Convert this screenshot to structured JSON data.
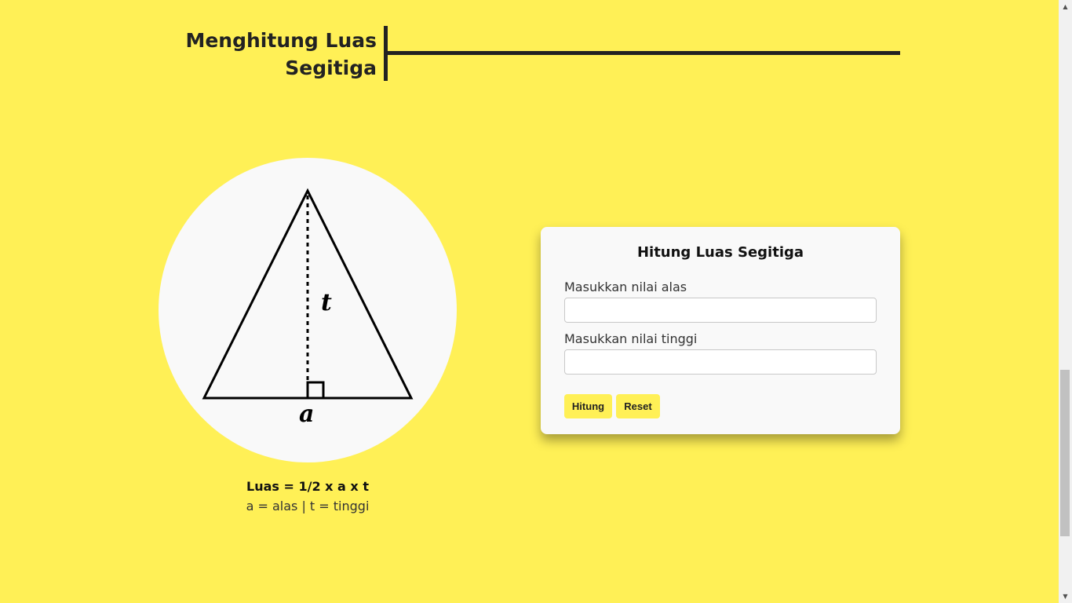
{
  "header": {
    "title_line1": "Menghitung Luas",
    "title_line2": "Segitiga"
  },
  "illustration": {
    "height_label": "t",
    "base_label": "a",
    "formula": "Luas = 1/2 x a x t",
    "legend": "a = alas | t = tinggi"
  },
  "form": {
    "title": "Hitung Luas Segitiga",
    "base_label": "Masukkan nilai alas",
    "base_value": "",
    "height_label": "Masukkan nilai tinggi",
    "height_value": "",
    "submit_label": "Hitung",
    "reset_label": "Reset"
  },
  "colors": {
    "background": "#fff056",
    "card": "#f9f9f9",
    "text": "#222222",
    "button": "#fff056"
  },
  "scrollbar": {
    "up_icon": "triangle-up-icon",
    "down_icon": "triangle-down-icon"
  }
}
